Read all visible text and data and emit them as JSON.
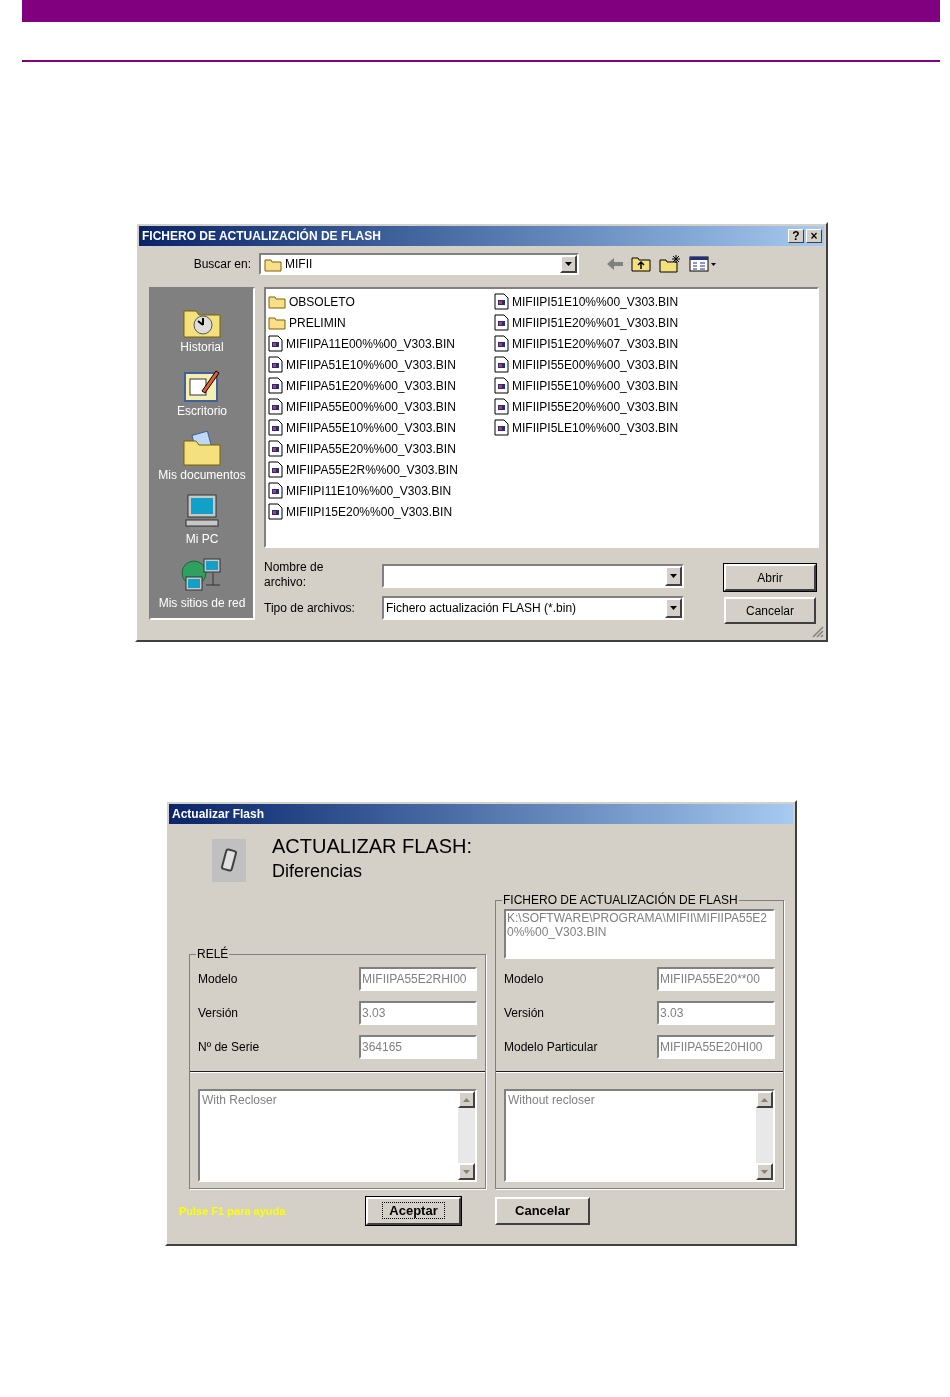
{
  "file_dialog": {
    "title": "FICHERO DE ACTUALIZACIÓN DE FLASH",
    "title_buttons": [
      "?",
      "×"
    ],
    "look_in": {
      "label": "Buscar en:",
      "value": "MIFII"
    },
    "places": [
      {
        "label": "Historial",
        "kind": "history"
      },
      {
        "label": "Escritorio",
        "kind": "desktop"
      },
      {
        "label": "Mis documentos",
        "kind": "documents"
      },
      {
        "label": "Mi PC",
        "kind": "computer"
      },
      {
        "label": "Mis sitios de red",
        "kind": "network"
      }
    ],
    "files": [
      {
        "name": "OBSOLETO",
        "kind": "folder"
      },
      {
        "name": "PRELIMIN",
        "kind": "folder"
      },
      {
        "name": "MIFIIPA11E00%%00_V303.BIN",
        "kind": "file"
      },
      {
        "name": "MIFIIPA51E10%%00_V303.BIN",
        "kind": "file"
      },
      {
        "name": "MIFIIPA51E20%%00_V303.BIN",
        "kind": "file"
      },
      {
        "name": "MIFIIPA55E00%%00_V303.BIN",
        "kind": "file"
      },
      {
        "name": "MIFIIPA55E10%%00_V303.BIN",
        "kind": "file"
      },
      {
        "name": "MIFIIPA55E20%%00_V303.BIN",
        "kind": "file"
      },
      {
        "name": "MIFIIPA55E2R%%00_V303.BIN",
        "kind": "file"
      },
      {
        "name": "MIFIIPI11E10%%00_V303.BIN",
        "kind": "file"
      },
      {
        "name": "MIFIIPI15E20%%00_V303.BIN",
        "kind": "file"
      },
      {
        "name": "MIFIIPI51E10%%00_V303.BIN",
        "kind": "file"
      },
      {
        "name": "MIFIIPI51E20%%01_V303.BIN",
        "kind": "file"
      },
      {
        "name": "MIFIIPI51E20%%07_V303.BIN",
        "kind": "file"
      },
      {
        "name": "MIFIIPI55E00%%00_V303.BIN",
        "kind": "file"
      },
      {
        "name": "MIFIIPI55E10%%00_V303.BIN",
        "kind": "file"
      },
      {
        "name": "MIFIIPI55E20%%00_V303.BIN",
        "kind": "file"
      },
      {
        "name": "MIFIIPI5LE10%%00_V303.BIN",
        "kind": "file"
      }
    ],
    "file_name": {
      "label": "Nombre de archivo:"
    },
    "file_type": {
      "label": "Tipo de archivos:",
      "value": "Fichero actualización FLASH (*.bin)"
    },
    "buttons": [
      {
        "label": "Abrir",
        "default": true
      },
      {
        "label": "Cancelar",
        "default": false
      }
    ]
  },
  "flash_dialog": {
    "title": "Actualizar Flash",
    "heading": "ACTUALIZAR FLASH:",
    "subheading": "Diferencias",
    "relay": {
      "legend": "RELÉ",
      "fields": [
        {
          "label": "Modelo",
          "value": "MIFIIPA55E2RHI00"
        },
        {
          "label": "Versión",
          "value": "3.03"
        },
        {
          "label": "Nº de Serie",
          "value": "364165"
        }
      ],
      "notes": "With Recloser"
    },
    "update_file": {
      "legend": "FICHERO DE ACTUALIZACIÓN DE FLASH",
      "path": "K:\\SOFTWARE\\PROGRAMA\\MIFII\\MIFIIPA55E20%%00_V303.BIN",
      "fields": [
        {
          "label": "Modelo",
          "value": "MIFIIPA55E20**00"
        },
        {
          "label": "Versión",
          "value": "3.03"
        },
        {
          "label": "Modelo Particular",
          "value": "MIFIIPA55E20HI00"
        }
      ],
      "notes": "Without recloser"
    },
    "help": "Pulse F1 para ayuda",
    "buttons": [
      {
        "label": "Aceptar",
        "default": true
      },
      {
        "label": "Cancelar",
        "default": false
      }
    ]
  }
}
